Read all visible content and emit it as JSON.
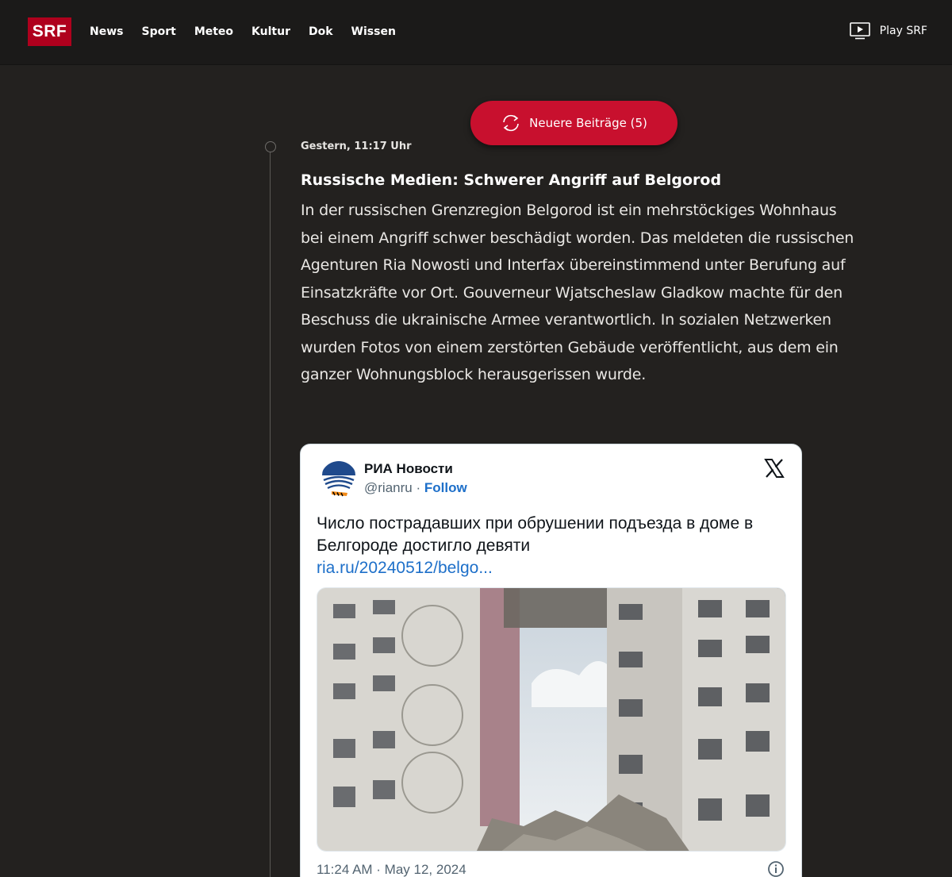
{
  "header": {
    "logo_text": "SRF",
    "nav": [
      "News",
      "Sport",
      "Meteo",
      "Kultur",
      "Dok",
      "Wissen"
    ],
    "play_label": "Play SRF"
  },
  "newer_button": {
    "label": "Neuere Beiträge (5)"
  },
  "post": {
    "timestamp": "Gestern, 11:17 Uhr",
    "title": "Russische Medien: Schwerer Angriff auf Belgorod",
    "body": "In der russischen Grenzregion Belgorod ist ein mehrstöckiges Wohnhaus bei einem Angriff schwer beschädigt worden. Das meldeten die russischen Agenturen Ria Nowosti und Interfax übereinstimmend unter Berufung auf Einsatzkräfte vor Ort. Gouverneur Wjatscheslaw Gladkow machte für den Beschuss die ukrainische Armee verantwortlich. In sozialen Netzwerken wurden Fotos von einem zerstörten Gebäude veröffentlicht, aus dem ein ganzer Wohnungsblock herausgerissen wurde."
  },
  "tweet": {
    "account_name": "РИА Новости",
    "handle": "@rianru",
    "separator": "·",
    "follow_label": "Follow",
    "text": "Число пострадавших при обрушении подъезда в доме в Белгороде достигло девяти",
    "link": "ria.ru/20240512/belgo...",
    "time": "11:24 AM · May 12, 2024"
  },
  "colors": {
    "brand_red": "#af001d",
    "button_red": "#c8102e",
    "link_blue": "#1d6fc9"
  },
  "icons": {
    "play": "tv-play-icon",
    "refresh": "refresh-icon",
    "x": "x-logo-icon",
    "info": "info-icon"
  }
}
